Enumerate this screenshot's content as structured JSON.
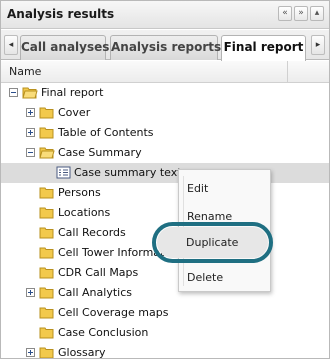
{
  "panel": {
    "title": "Analysis results",
    "header_buttons": [
      "«",
      "»",
      "▴"
    ]
  },
  "tabs": {
    "scroll_left": "◂",
    "scroll_right": "▸",
    "items": [
      {
        "label": "Call analyses"
      },
      {
        "label": "Analysis reports"
      },
      {
        "label": "Final report",
        "active": true
      }
    ]
  },
  "column_header": {
    "name": "Name"
  },
  "tree": {
    "items": [
      {
        "label": "Final report",
        "expander": "minus",
        "icon": "folder-open-icon"
      },
      {
        "label": "Cover",
        "expander": "plus",
        "icon": "folder-icon"
      },
      {
        "label": "Table of Contents",
        "expander": "plus",
        "icon": "folder-icon"
      },
      {
        "label": "Case Summary",
        "expander": "minus",
        "icon": "folder-open-icon"
      },
      {
        "label": "Case summary text",
        "icon": "text-document-icon",
        "selected": true
      },
      {
        "label": "Persons",
        "icon": "folder-icon"
      },
      {
        "label": "Locations",
        "icon": "folder-icon"
      },
      {
        "label": "Call Records",
        "icon": "folder-icon"
      },
      {
        "label": "Cell Tower Information",
        "icon": "folder-icon"
      },
      {
        "label": "CDR Call Maps",
        "icon": "folder-icon"
      },
      {
        "label": "Call Analytics",
        "expander": "plus",
        "icon": "folder-icon"
      },
      {
        "label": "Cell Coverage maps",
        "icon": "folder-icon"
      },
      {
        "label": "Case Conclusion",
        "icon": "folder-icon"
      },
      {
        "label": "Glossary",
        "expander": "plus",
        "icon": "folder-icon"
      }
    ]
  },
  "context_menu": {
    "items": [
      {
        "label": "Edit"
      },
      {
        "label": "Rename"
      },
      {
        "label": "Duplicate",
        "highlighted": true
      },
      {
        "label": "Delete"
      }
    ]
  },
  "colors": {
    "highlight_ring": "#1f6f82",
    "folder": "#f2c94c"
  }
}
